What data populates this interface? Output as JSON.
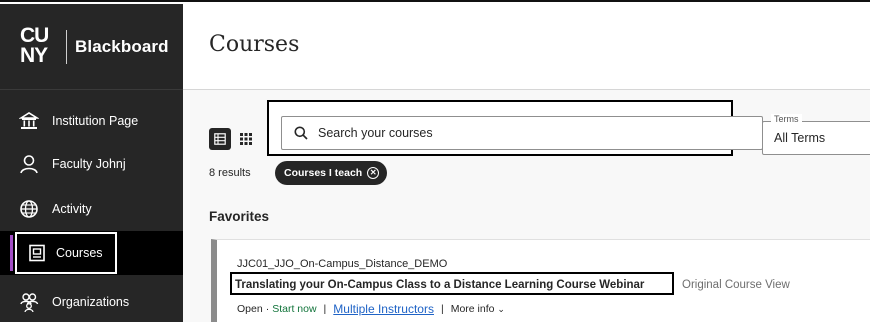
{
  "brand": {
    "logo": "CUNY",
    "logo_top": "CU",
    "logo_bottom": "NY",
    "name": "Blackboard"
  },
  "sidebar": {
    "items": [
      {
        "label": "Institution Page",
        "icon": "institution-icon"
      },
      {
        "label": "Faculty Johnj",
        "icon": "user-icon"
      },
      {
        "label": "Activity",
        "icon": "globe-icon"
      },
      {
        "label": "Courses",
        "icon": "courses-icon",
        "active": true
      },
      {
        "label": "Organizations",
        "icon": "organizations-icon"
      }
    ]
  },
  "main": {
    "title": "Courses",
    "search": {
      "placeholder": "Search your courses",
      "value": ""
    },
    "terms": {
      "label": "Terms",
      "value": "All Terms"
    },
    "results": "8 results",
    "filter_chip": "Courses I teach",
    "section": "Favorites",
    "course": {
      "code": "JJC01_JJO_On-Campus_Distance_DEMO",
      "title": "Translating your On-Campus Class to a Distance Learning Course Webinar",
      "view": "Original Course View",
      "status": "Open",
      "start": "Start now",
      "instructors": "Multiple Instructors",
      "more_info": "More info"
    }
  },
  "colors": {
    "sidebar_bg": "#262626",
    "active_accent": "#a24fc6",
    "link": "#1f63c6",
    "start_green": "#12743b"
  }
}
